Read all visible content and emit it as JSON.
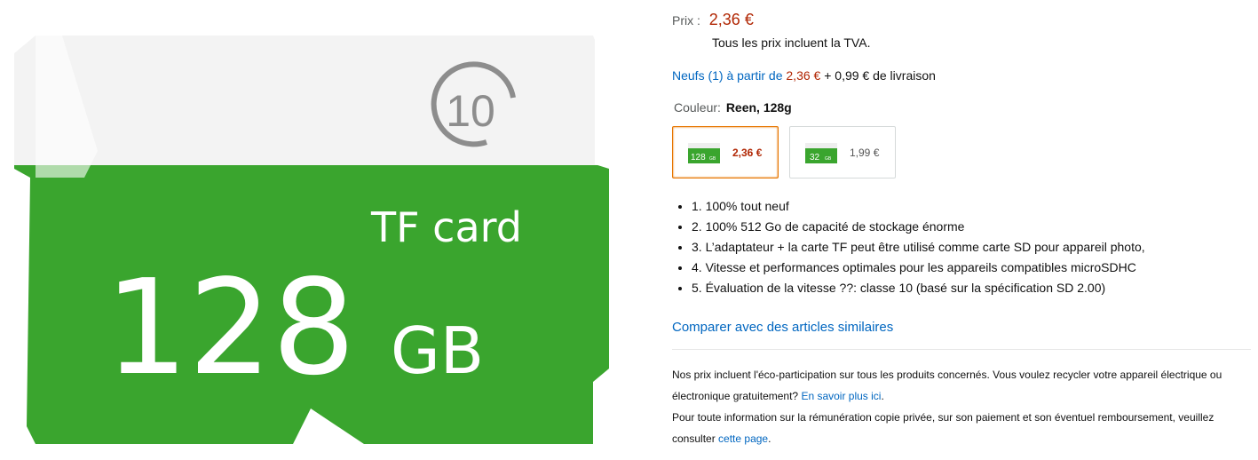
{
  "product_image": {
    "class_mark": "10",
    "card_type": "TF card",
    "capacity_number": "128",
    "capacity_unit": "GB",
    "colors": {
      "card_green": "#3aa52e",
      "card_white": "#f2f2f2"
    }
  },
  "price": {
    "label": "Prix :",
    "value": "2,36 €",
    "vat_note": "Tous les prix incluent la TVA."
  },
  "offers": {
    "link": "Neufs (1) à partir de",
    "price": "2,36 €",
    "shipping": "+ 0,99 € de livraison"
  },
  "color": {
    "label": "Couleur:",
    "value": "Reen, 128g"
  },
  "swatches": [
    {
      "thumb_text": "128",
      "thumb_unit": "GB",
      "price": "2,36 €"
    },
    {
      "thumb_text": "32",
      "thumb_unit": "GB",
      "price": "1,99 €"
    }
  ],
  "bullets": [
    "1. 100% tout neuf",
    "2. 100% 512 Go de capacité de stockage énorme",
    "3. L’adaptateur + la carte TF peut être utilisé comme carte SD pour appareil photo,",
    "4. Vitesse et performances optimales pour les appareils compatibles microSDHC",
    "5. Évaluation de la vitesse ??: classe 10 (basé sur la spécification SD 2.00)"
  ],
  "compare_link": "Comparer avec des articles similaires",
  "notes": {
    "eco_text": "Nos prix incluent l'éco-participation sur tous les produits concernés. Vous voulez recycler votre appareil électrique ou électronique gratuitement?",
    "eco_link": "En savoir plus ici",
    "eco_end": ".",
    "copy_text": "Pour toute information sur la rémunération copie privée, sur son paiement et son éventuel remboursement, veuillez consulter",
    "copy_link": "cette page",
    "copy_end": "."
  },
  "accent_colors": {
    "price_red": "#b12704",
    "link_blue": "#0066c0",
    "selected_border": "#e77600"
  }
}
